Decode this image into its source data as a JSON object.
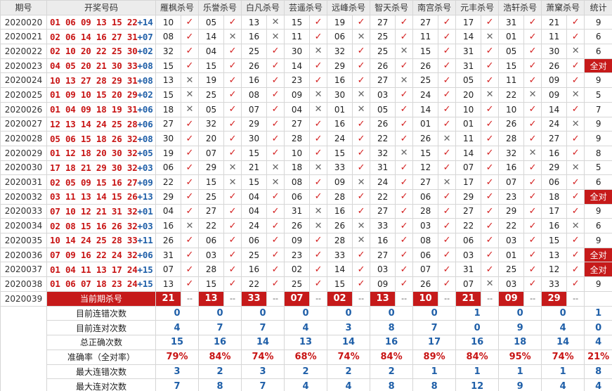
{
  "header": {
    "issue": "期号",
    "winning": "开奖号码",
    "experts": [
      "雁枫杀号",
      "乐誉杀号",
      "白凡杀号",
      "芸遥杀号",
      "远峰杀号",
      "智天杀号",
      "南宫杀号",
      "元丰杀号",
      "浩轩杀号",
      "萧窠杀号"
    ],
    "stats": "统计"
  },
  "rows": [
    {
      "issue": "2020020",
      "red": "01 06 09 13 15 22",
      "blue": "+14",
      "k": [
        [
          "10",
          "ok"
        ],
        [
          "05",
          "ok"
        ],
        [
          "13",
          "no"
        ],
        [
          "15",
          "ok"
        ],
        [
          "19",
          "ok"
        ],
        [
          "27",
          "ok"
        ],
        [
          "27",
          "ok"
        ],
        [
          "17",
          "ok"
        ],
        [
          "31",
          "ok"
        ],
        [
          "21",
          "ok"
        ]
      ],
      "total": "9"
    },
    {
      "issue": "2020021",
      "red": "02 06 14 16 27 31",
      "blue": "+07",
      "k": [
        [
          "08",
          "ok"
        ],
        [
          "14",
          "no"
        ],
        [
          "16",
          "no"
        ],
        [
          "11",
          "ok"
        ],
        [
          "06",
          "no"
        ],
        [
          "25",
          "ok"
        ],
        [
          "11",
          "ok"
        ],
        [
          "14",
          "no"
        ],
        [
          "01",
          "ok"
        ],
        [
          "11",
          "ok"
        ]
      ],
      "total": "6"
    },
    {
      "issue": "2020022",
      "red": "02 10 20 22 25 30",
      "blue": "+02",
      "k": [
        [
          "32",
          "ok"
        ],
        [
          "04",
          "ok"
        ],
        [
          "25",
          "ok"
        ],
        [
          "30",
          "no"
        ],
        [
          "32",
          "ok"
        ],
        [
          "25",
          "no"
        ],
        [
          "15",
          "ok"
        ],
        [
          "31",
          "ok"
        ],
        [
          "05",
          "ok"
        ],
        [
          "30",
          "no"
        ]
      ],
      "total": "6"
    },
    {
      "issue": "2020023",
      "red": "04 05 20 21 30 33",
      "blue": "+08",
      "k": [
        [
          "15",
          "ok"
        ],
        [
          "15",
          "ok"
        ],
        [
          "26",
          "ok"
        ],
        [
          "14",
          "ok"
        ],
        [
          "29",
          "ok"
        ],
        [
          "26",
          "ok"
        ],
        [
          "26",
          "ok"
        ],
        [
          "31",
          "ok"
        ],
        [
          "15",
          "ok"
        ],
        [
          "26",
          "ok"
        ]
      ],
      "total": "全对"
    },
    {
      "issue": "2020024",
      "red": "10 13 27 28 29 31",
      "blue": "+08",
      "k": [
        [
          "13",
          "no"
        ],
        [
          "19",
          "ok"
        ],
        [
          "16",
          "ok"
        ],
        [
          "23",
          "ok"
        ],
        [
          "16",
          "ok"
        ],
        [
          "27",
          "no"
        ],
        [
          "25",
          "ok"
        ],
        [
          "05",
          "ok"
        ],
        [
          "11",
          "ok"
        ],
        [
          "09",
          "ok"
        ]
      ],
      "total": "9"
    },
    {
      "issue": "2020025",
      "red": "01 09 10 15 20 29",
      "blue": "+02",
      "k": [
        [
          "15",
          "no"
        ],
        [
          "25",
          "ok"
        ],
        [
          "08",
          "ok"
        ],
        [
          "09",
          "no"
        ],
        [
          "30",
          "no"
        ],
        [
          "03",
          "ok"
        ],
        [
          "24",
          "ok"
        ],
        [
          "20",
          "no"
        ],
        [
          "22",
          "no"
        ],
        [
          "09",
          "no"
        ]
      ],
      "total": "5"
    },
    {
      "issue": "2020026",
      "red": "01 04 09 18 19 31",
      "blue": "+06",
      "k": [
        [
          "18",
          "no"
        ],
        [
          "05",
          "ok"
        ],
        [
          "07",
          "ok"
        ],
        [
          "04",
          "no"
        ],
        [
          "01",
          "no"
        ],
        [
          "05",
          "ok"
        ],
        [
          "14",
          "ok"
        ],
        [
          "10",
          "ok"
        ],
        [
          "10",
          "ok"
        ],
        [
          "14",
          "ok"
        ]
      ],
      "total": "7"
    },
    {
      "issue": "2020027",
      "red": "12 13 14 24 25 28",
      "blue": "+06",
      "k": [
        [
          "27",
          "ok"
        ],
        [
          "32",
          "ok"
        ],
        [
          "29",
          "ok"
        ],
        [
          "27",
          "ok"
        ],
        [
          "16",
          "ok"
        ],
        [
          "26",
          "ok"
        ],
        [
          "01",
          "ok"
        ],
        [
          "01",
          "ok"
        ],
        [
          "26",
          "ok"
        ],
        [
          "24",
          "no"
        ]
      ],
      "total": "9"
    },
    {
      "issue": "2020028",
      "red": "05 06 15 18 26 32",
      "blue": "+08",
      "k": [
        [
          "30",
          "ok"
        ],
        [
          "20",
          "ok"
        ],
        [
          "30",
          "ok"
        ],
        [
          "28",
          "ok"
        ],
        [
          "24",
          "ok"
        ],
        [
          "22",
          "ok"
        ],
        [
          "26",
          "no"
        ],
        [
          "11",
          "ok"
        ],
        [
          "28",
          "ok"
        ],
        [
          "27",
          "ok"
        ]
      ],
      "total": "9"
    },
    {
      "issue": "2020029",
      "red": "01 12 18 20 30 32",
      "blue": "+05",
      "k": [
        [
          "19",
          "ok"
        ],
        [
          "07",
          "ok"
        ],
        [
          "15",
          "ok"
        ],
        [
          "10",
          "ok"
        ],
        [
          "15",
          "ok"
        ],
        [
          "32",
          "no"
        ],
        [
          "15",
          "ok"
        ],
        [
          "14",
          "ok"
        ],
        [
          "32",
          "no"
        ],
        [
          "16",
          "ok"
        ]
      ],
      "total": "8"
    },
    {
      "issue": "2020030",
      "red": "17 18 21 29 30 32",
      "blue": "+03",
      "k": [
        [
          "06",
          "ok"
        ],
        [
          "29",
          "no"
        ],
        [
          "21",
          "no"
        ],
        [
          "18",
          "no"
        ],
        [
          "33",
          "ok"
        ],
        [
          "31",
          "ok"
        ],
        [
          "12",
          "ok"
        ],
        [
          "07",
          "ok"
        ],
        [
          "16",
          "ok"
        ],
        [
          "29",
          "no"
        ]
      ],
      "total": "5"
    },
    {
      "issue": "2020031",
      "red": "02 05 09 15 16 27",
      "blue": "+09",
      "k": [
        [
          "22",
          "ok"
        ],
        [
          "15",
          "no"
        ],
        [
          "15",
          "no"
        ],
        [
          "08",
          "ok"
        ],
        [
          "09",
          "no"
        ],
        [
          "24",
          "ok"
        ],
        [
          "27",
          "no"
        ],
        [
          "17",
          "ok"
        ],
        [
          "07",
          "ok"
        ],
        [
          "06",
          "ok"
        ]
      ],
      "total": "6"
    },
    {
      "issue": "2020032",
      "red": "03 11 13 14 15 26",
      "blue": "+13",
      "k": [
        [
          "29",
          "ok"
        ],
        [
          "25",
          "ok"
        ],
        [
          "04",
          "ok"
        ],
        [
          "06",
          "ok"
        ],
        [
          "28",
          "ok"
        ],
        [
          "22",
          "ok"
        ],
        [
          "06",
          "ok"
        ],
        [
          "29",
          "ok"
        ],
        [
          "23",
          "ok"
        ],
        [
          "18",
          "ok"
        ]
      ],
      "total": "全对"
    },
    {
      "issue": "2020033",
      "red": "07 10 12 21 31 32",
      "blue": "+01",
      "k": [
        [
          "04",
          "ok"
        ],
        [
          "27",
          "ok"
        ],
        [
          "04",
          "ok"
        ],
        [
          "31",
          "no"
        ],
        [
          "16",
          "ok"
        ],
        [
          "27",
          "ok"
        ],
        [
          "28",
          "ok"
        ],
        [
          "27",
          "ok"
        ],
        [
          "29",
          "ok"
        ],
        [
          "17",
          "ok"
        ]
      ],
      "total": "9"
    },
    {
      "issue": "2020034",
      "red": "02 08 15 16 26 32",
      "blue": "+03",
      "k": [
        [
          "16",
          "no"
        ],
        [
          "22",
          "ok"
        ],
        [
          "24",
          "ok"
        ],
        [
          "26",
          "no"
        ],
        [
          "26",
          "no"
        ],
        [
          "33",
          "ok"
        ],
        [
          "03",
          "ok"
        ],
        [
          "22",
          "ok"
        ],
        [
          "22",
          "ok"
        ],
        [
          "16",
          "no"
        ]
      ],
      "total": "6"
    },
    {
      "issue": "2020035",
      "red": "10 14 24 25 28 33",
      "blue": "+11",
      "k": [
        [
          "26",
          "ok"
        ],
        [
          "06",
          "ok"
        ],
        [
          "06",
          "ok"
        ],
        [
          "09",
          "ok"
        ],
        [
          "28",
          "no"
        ],
        [
          "16",
          "ok"
        ],
        [
          "08",
          "ok"
        ],
        [
          "06",
          "ok"
        ],
        [
          "03",
          "ok"
        ],
        [
          "15",
          "ok"
        ]
      ],
      "total": "9"
    },
    {
      "issue": "2020036",
      "red": "07 09 16 22 24 32",
      "blue": "+06",
      "k": [
        [
          "31",
          "ok"
        ],
        [
          "03",
          "ok"
        ],
        [
          "25",
          "ok"
        ],
        [
          "23",
          "ok"
        ],
        [
          "33",
          "ok"
        ],
        [
          "27",
          "ok"
        ],
        [
          "06",
          "ok"
        ],
        [
          "03",
          "ok"
        ],
        [
          "01",
          "ok"
        ],
        [
          "13",
          "ok"
        ]
      ],
      "total": "全对"
    },
    {
      "issue": "2020037",
      "red": "01 04 11 13 17 24",
      "blue": "+15",
      "k": [
        [
          "07",
          "ok"
        ],
        [
          "28",
          "ok"
        ],
        [
          "16",
          "ok"
        ],
        [
          "02",
          "ok"
        ],
        [
          "14",
          "ok"
        ],
        [
          "03",
          "ok"
        ],
        [
          "07",
          "ok"
        ],
        [
          "31",
          "ok"
        ],
        [
          "25",
          "ok"
        ],
        [
          "12",
          "ok"
        ]
      ],
      "total": "全对"
    },
    {
      "issue": "2020038",
      "red": "01 06 07 18 23 24",
      "blue": "+15",
      "k": [
        [
          "13",
          "ok"
        ],
        [
          "15",
          "ok"
        ],
        [
          "22",
          "ok"
        ],
        [
          "25",
          "ok"
        ],
        [
          "15",
          "ok"
        ],
        [
          "09",
          "ok"
        ],
        [
          "26",
          "ok"
        ],
        [
          "07",
          "no"
        ],
        [
          "03",
          "ok"
        ],
        [
          "33",
          "ok"
        ]
      ],
      "total": "9"
    }
  ],
  "current": {
    "issue": "2020039",
    "label": "当前期杀号",
    "kills": [
      "21",
      "13",
      "33",
      "07",
      "02",
      "13",
      "10",
      "21",
      "09",
      "29"
    ],
    "dash": "--"
  },
  "stats": [
    {
      "label": "目前连错次数",
      "values": [
        "0",
        "0",
        "0",
        "0",
        "0",
        "0",
        "0",
        "1",
        "0",
        "0"
      ],
      "total": "1",
      "rate": false
    },
    {
      "label": "目前连对次数",
      "values": [
        "4",
        "7",
        "7",
        "4",
        "3",
        "8",
        "7",
        "0",
        "9",
        "4"
      ],
      "total": "0",
      "rate": false
    },
    {
      "label": "总正确次数",
      "values": [
        "15",
        "16",
        "14",
        "13",
        "14",
        "16",
        "17",
        "16",
        "18",
        "14"
      ],
      "total": "4",
      "rate": false
    },
    {
      "label": "准确率（全对率）",
      "values": [
        "79%",
        "84%",
        "74%",
        "68%",
        "74%",
        "84%",
        "89%",
        "84%",
        "95%",
        "74%"
      ],
      "total": "21%",
      "rate": true
    },
    {
      "label": "最大连错次数",
      "values": [
        "3",
        "2",
        "3",
        "2",
        "2",
        "2",
        "1",
        "1",
        "1",
        "1"
      ],
      "total": "8",
      "rate": false
    },
    {
      "label": "最大连对次数",
      "values": [
        "7",
        "8",
        "7",
        "4",
        "4",
        "8",
        "8",
        "12",
        "9",
        "4"
      ],
      "total": "4",
      "rate": false
    }
  ],
  "marks": {
    "ok": "✓",
    "no": "✕"
  },
  "colors": {
    "red": "#c81414",
    "blue": "#1f5fa8",
    "accent": "#c61a1a",
    "ok": "#d42020",
    "no": "#666666"
  }
}
